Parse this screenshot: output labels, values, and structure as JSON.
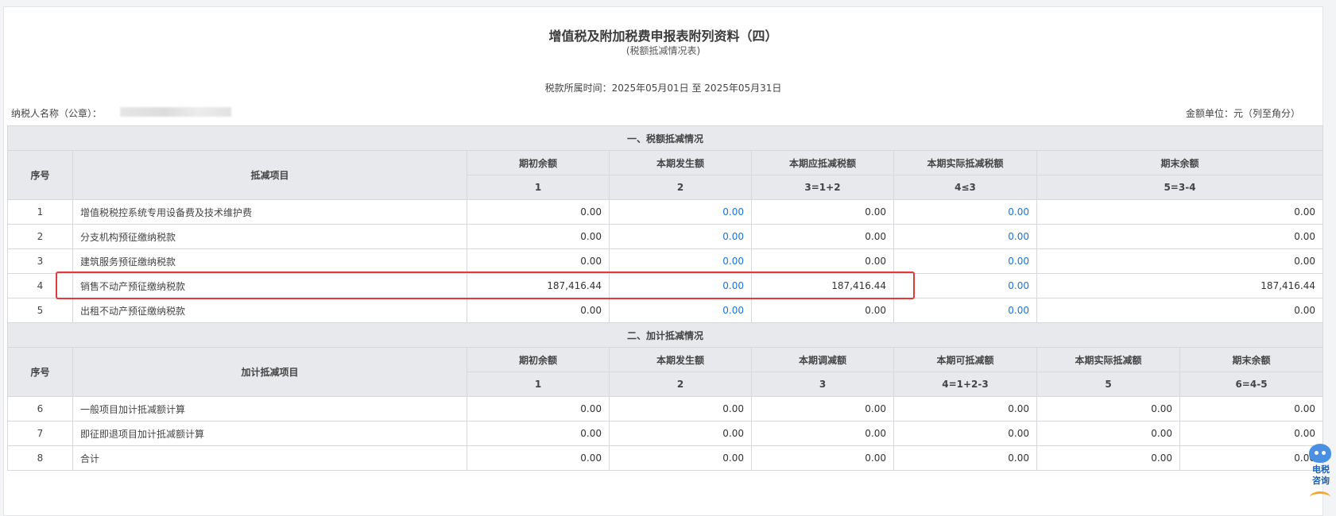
{
  "header": {
    "title": "增值税及附加税费申报表附列资料（四）",
    "subtitle": "(税额抵减情况表)",
    "period": "税款所属时间：2025年05月01日 至 2025年05月31日",
    "taxpayer_label": "纳税人名称（公章）：",
    "unit": "金额单位：元（列至角分）"
  },
  "section1": {
    "title": "一、税额抵减情况",
    "seq_header": "序号",
    "item_header": "抵减项目",
    "columns": [
      "期初余额",
      "本期发生额",
      "本期应抵减税额",
      "本期实际抵减税额",
      "期末余额"
    ],
    "column_numbers": [
      "1",
      "2",
      "3=1+2",
      "4≤3",
      "5=3-4"
    ],
    "rows": [
      {
        "seq": "1",
        "name": "增值税税控系统专用设备费及技术维护费",
        "values": [
          "0.00",
          "0.00",
          "0.00",
          "0.00",
          "0.00"
        ]
      },
      {
        "seq": "2",
        "name": "分支机构预征缴纳税款",
        "values": [
          "0.00",
          "0.00",
          "0.00",
          "0.00",
          "0.00"
        ]
      },
      {
        "seq": "3",
        "name": "建筑服务预征缴纳税款",
        "values": [
          "0.00",
          "0.00",
          "0.00",
          "0.00",
          "0.00"
        ]
      },
      {
        "seq": "4",
        "name": "销售不动产预征缴纳税款",
        "values": [
          "187,416.44",
          "0.00",
          "187,416.44",
          "0.00",
          "187,416.44"
        ]
      },
      {
        "seq": "5",
        "name": "出租不动产预征缴纳税款",
        "values": [
          "0.00",
          "0.00",
          "0.00",
          "0.00",
          "0.00"
        ]
      }
    ]
  },
  "section2": {
    "title": "二、加计抵减情况",
    "seq_header": "序号",
    "item_header": "加计抵减项目",
    "columns": [
      "期初余额",
      "本期发生额",
      "本期调减额",
      "本期可抵减额",
      "本期实际抵减额",
      "期末余额"
    ],
    "column_numbers": [
      "1",
      "2",
      "3",
      "4=1+2-3",
      "5",
      "6=4-5"
    ],
    "rows": [
      {
        "seq": "6",
        "name": "一般项目加计抵减额计算",
        "values": [
          "0.00",
          "0.00",
          "0.00",
          "0.00",
          "0.00",
          "0.00"
        ]
      },
      {
        "seq": "7",
        "name": "即征即退项目加计抵减额计算",
        "values": [
          "0.00",
          "0.00",
          "0.00",
          "0.00",
          "0.00",
          "0.00"
        ]
      },
      {
        "seq": "8",
        "name": "合计",
        "values": [
          "0.00",
          "0.00",
          "0.00",
          "0.00",
          "0.00",
          "0.00"
        ]
      }
    ]
  },
  "assistant": {
    "label_line1": "电税",
    "label_line2": "咨询"
  },
  "colors": {
    "link": "#1a73d9",
    "highlight": "#e53935",
    "header_bg": "#e8e9ed"
  }
}
